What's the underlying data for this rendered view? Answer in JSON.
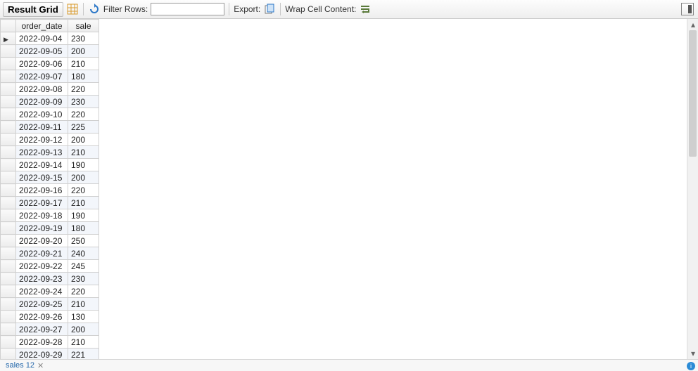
{
  "toolbar": {
    "result_grid_label": "Result Grid",
    "filter_label": "Filter Rows:",
    "filter_value": "",
    "export_label": "Export:",
    "wrap_label": "Wrap Cell Content:"
  },
  "grid": {
    "columns": [
      "order_date",
      "sale"
    ],
    "rows": [
      {
        "order_date": "2022-09-04",
        "sale": "230"
      },
      {
        "order_date": "2022-09-05",
        "sale": "200"
      },
      {
        "order_date": "2022-09-06",
        "sale": "210"
      },
      {
        "order_date": "2022-09-07",
        "sale": "180"
      },
      {
        "order_date": "2022-09-08",
        "sale": "220"
      },
      {
        "order_date": "2022-09-09",
        "sale": "230"
      },
      {
        "order_date": "2022-09-10",
        "sale": "220"
      },
      {
        "order_date": "2022-09-11",
        "sale": "225"
      },
      {
        "order_date": "2022-09-12",
        "sale": "200"
      },
      {
        "order_date": "2022-09-13",
        "sale": "210"
      },
      {
        "order_date": "2022-09-14",
        "sale": "190"
      },
      {
        "order_date": "2022-09-15",
        "sale": "200"
      },
      {
        "order_date": "2022-09-16",
        "sale": "220"
      },
      {
        "order_date": "2022-09-17",
        "sale": "210"
      },
      {
        "order_date": "2022-09-18",
        "sale": "190"
      },
      {
        "order_date": "2022-09-19",
        "sale": "180"
      },
      {
        "order_date": "2022-09-20",
        "sale": "250"
      },
      {
        "order_date": "2022-09-21",
        "sale": "240"
      },
      {
        "order_date": "2022-09-22",
        "sale": "245"
      },
      {
        "order_date": "2022-09-23",
        "sale": "230"
      },
      {
        "order_date": "2022-09-24",
        "sale": "220"
      },
      {
        "order_date": "2022-09-25",
        "sale": "210"
      },
      {
        "order_date": "2022-09-26",
        "sale": "130"
      },
      {
        "order_date": "2022-09-27",
        "sale": "200"
      },
      {
        "order_date": "2022-09-28",
        "sale": "210"
      },
      {
        "order_date": "2022-09-29",
        "sale": "221"
      }
    ]
  },
  "tabs": {
    "active_label": "sales 12"
  },
  "scrollbar": {
    "up_glyph": "▴",
    "down_glyph": "▾"
  },
  "info_glyph": "i"
}
